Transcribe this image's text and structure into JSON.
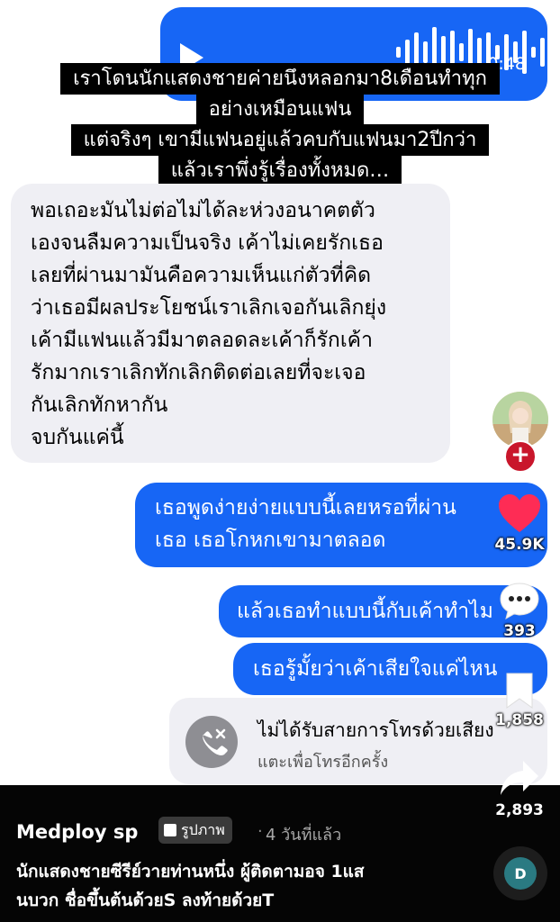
{
  "voice_message": {
    "duration": "0:48"
  },
  "caption_lines": [
    "เราโดนนักแสดงชายค่ายนึงหลอกมา8เดือนทำทุก",
    "อย่างเหมือนแฟน",
    "แต่จริงๆ เขามีแฟนอยู่แล้วคบกับแฟนมา2ปีกว่า",
    "แล้วเราพึ่งรู้เรื่องทั้งหมด…"
  ],
  "messages": [
    {
      "direction": "incoming",
      "lines": [
        "พอเถอะมันไม่ต่อไม่ได้ละห่วงอนาคตตัว",
        "เองจนลืมความเป็นจริง เค้าไม่เคยรักเธอ",
        "เลยที่ผ่านมามันคือความเห็นแก่ตัวที่คิด",
        "ว่าเธอมีผลประโยชน์เราเลิกเจอกันเลิกยุ่ง",
        "เค้ามีแฟนแล้วมีมาตลอดละเค้าก็รักเค้า",
        "รักมากเราเลิกทักเลิกติดต่อเลยที่จะเจอ",
        "กันเลิกทักหากัน",
        "จบกันแค่นี้"
      ]
    },
    {
      "direction": "outgoing",
      "lines": [
        "เธอพูดง่ายง่ายแบบนี้เลยหรอที่ผ่าน",
        "เธอ เธอโกหกเขามาตลอด"
      ]
    },
    {
      "direction": "outgoing",
      "lines": [
        "แล้วเธอทำแบบนี้กับเค้าทำไม"
      ]
    },
    {
      "direction": "outgoing",
      "lines": [
        "เธอรู้มั้ยว่าเค้าเสียใจแค่ไหน"
      ]
    }
  ],
  "missed_call": {
    "title": "ไม่ได้รับสายการโทรด้วยเสียง",
    "subtitle": "แตะเพื่อโทรอีกครั้ง"
  },
  "actions": {
    "likes": "45.9K",
    "comments": "393",
    "saves": "1,858",
    "shares": "2,893"
  },
  "post": {
    "author": "Medploy sp",
    "badge": "รูปภาพ",
    "posted": "4 วันที่แล้ว",
    "description_lines": [
      "นักแสดงชายซีรีย์วายท่านหนึ่ง ผู้ติดตามอจ 1แส",
      "นบวก ชื่อขึ้นต้นด้วยS ลงท้ายด้วยT"
    ]
  },
  "colors": {
    "outgoing_bubble": "#1766f5",
    "incoming_bubble": "#efeff4",
    "like_heart": "#fe2c55",
    "follow": "#c9162b"
  },
  "icons": [
    "play-icon",
    "heart-icon",
    "comment-icon",
    "bookmark-icon",
    "share-icon",
    "missed-call-icon",
    "photo-icon",
    "music-disc-icon"
  ]
}
